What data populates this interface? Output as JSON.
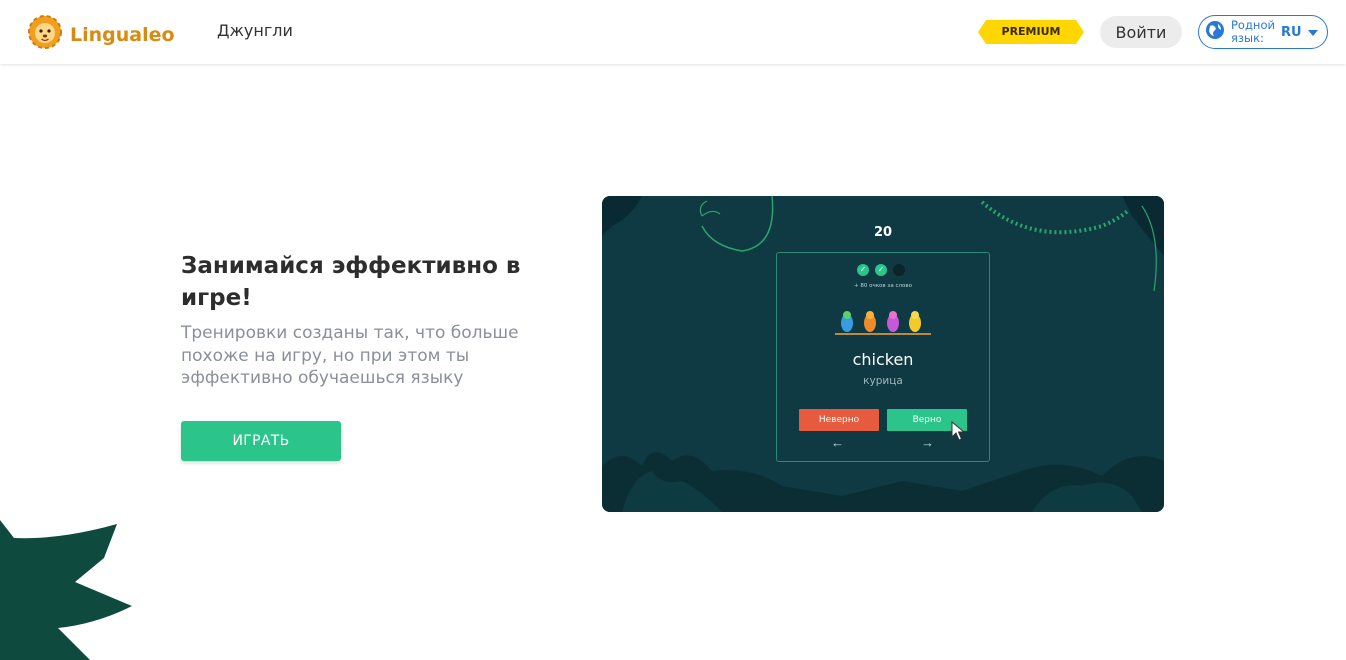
{
  "header": {
    "logo_text": "Lingualeo",
    "nav_link": "Джунгли",
    "premium_label": "PREMIUM",
    "login_label": "Войти",
    "language": {
      "caption": "Родной язык:",
      "code": "RU"
    }
  },
  "hero": {
    "headline": "Занимайся эффективно в игре!",
    "description": "Тренировки созданы так, что больше похоже на игру, но при этом ты эффективно обучаешься языку",
    "play_label": "ИГРАТЬ"
  },
  "preview": {
    "score": "20",
    "points_hint": "+ 80 очков за слово",
    "word": "chicken",
    "translation": "курица",
    "wrong_label": "Неверно",
    "right_label": "Верно",
    "prev_arrow": "←",
    "next_arrow": "→",
    "progress_dots": [
      "done",
      "done",
      "pending"
    ]
  },
  "colors": {
    "brand": "#d98a11",
    "accent_green": "#2bc48a",
    "wrong_red": "#e65a3d",
    "link_blue": "#2a78d6",
    "premium_yellow": "#ffd600",
    "preview_bg": "#0f3a44",
    "leaf_green": "#0f4a3e"
  },
  "icons": {
    "logo": "lion-icon",
    "language": "globe-icon",
    "caret": "caret-down-icon",
    "cursor": "mouse-pointer-icon"
  }
}
